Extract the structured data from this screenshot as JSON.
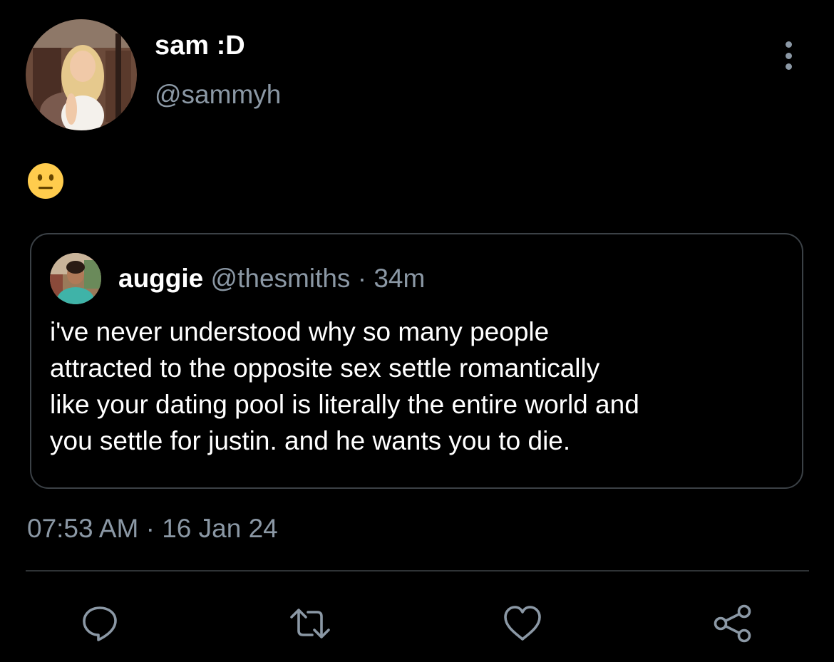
{
  "tweet": {
    "author": {
      "display_name": "sam :D",
      "handle": "@sammyh"
    },
    "body_emoji": "neutral-face-emoji",
    "timestamp": "07:53 AM · 16 Jan 24"
  },
  "quoted_tweet": {
    "author_name": "auggie",
    "author_handle": "@thesmiths",
    "separator": " · ",
    "age": "34m",
    "text": "i've never understood why so many people\nattracted to the opposite sex settle romantically\nlike your dating pool is literally the entire world and\nyou settle for justin. and he wants you to die."
  },
  "actions": [
    {
      "name": "reply",
      "icon": "speech-bubble-icon"
    },
    {
      "name": "retweet",
      "icon": "retweet-icon"
    },
    {
      "name": "like",
      "icon": "heart-icon"
    },
    {
      "name": "share",
      "icon": "share-icon"
    }
  ],
  "colors": {
    "background": "#000000",
    "primary_text": "#ffffff",
    "secondary_text": "#8b98a5",
    "border": "#3b4146",
    "emoji_yellow": "#ffcc4d"
  }
}
